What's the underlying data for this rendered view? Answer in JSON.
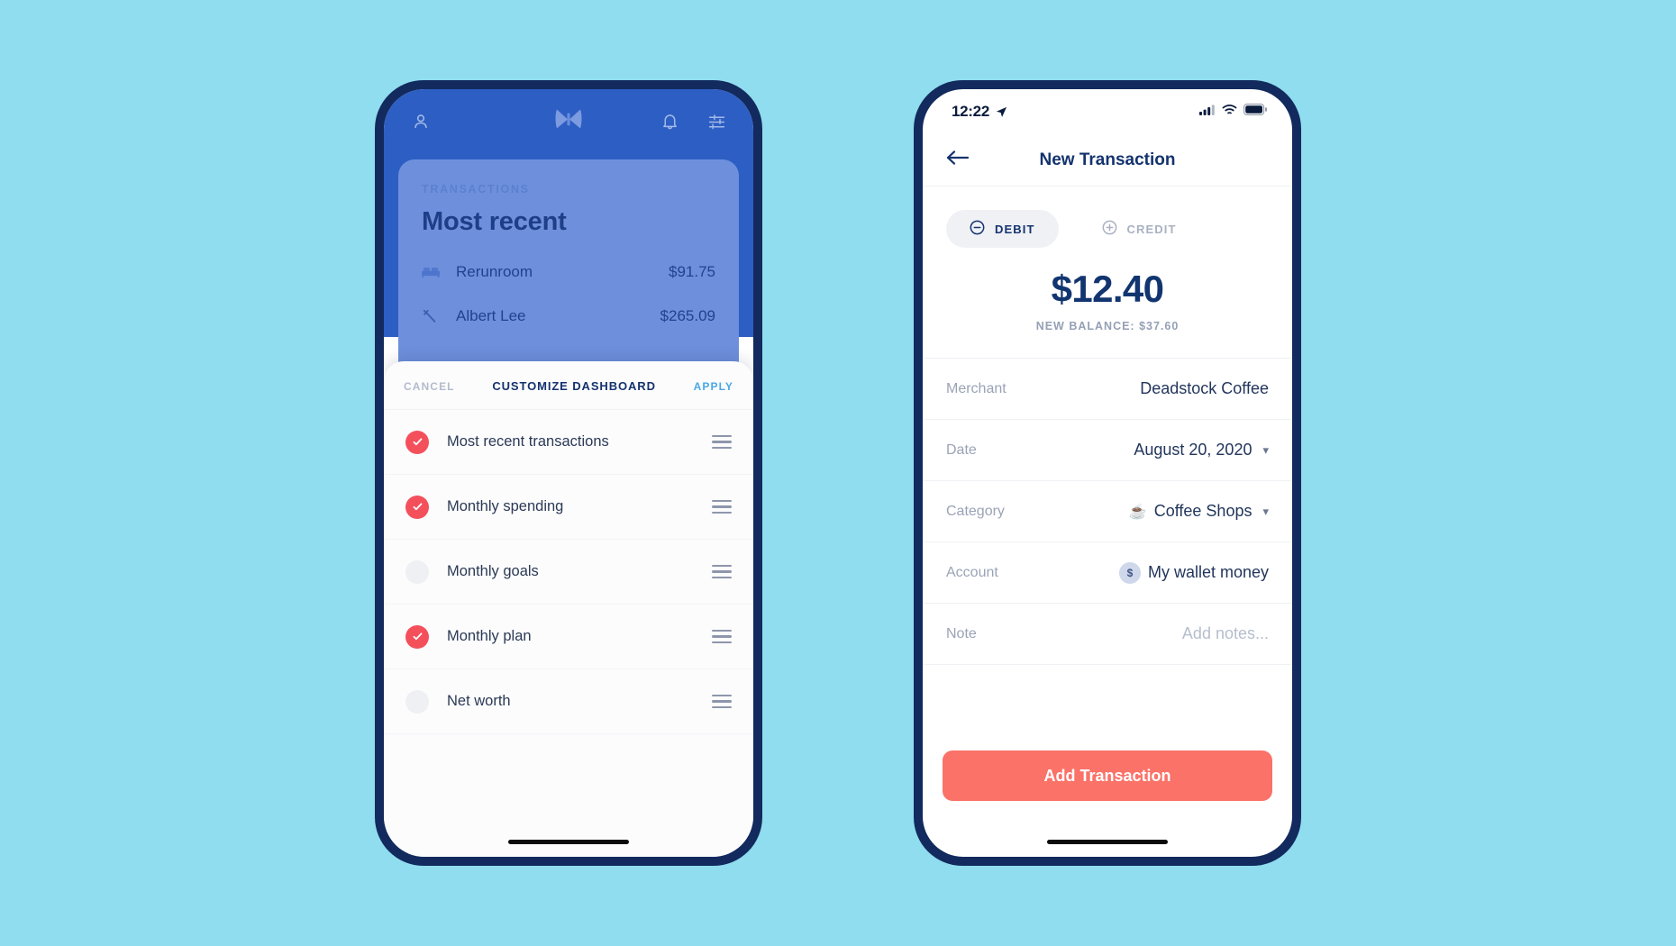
{
  "canvas": {
    "background_color": "#8FDDEE"
  },
  "left_phone": {
    "topbar": {
      "profile_icon": "person-icon",
      "logo_icon": "butterfly-logo-icon",
      "notifications_icon": "bell-icon",
      "settings_icon": "sliders-icon"
    },
    "transactions_card": {
      "kicker": "TRANSACTIONS",
      "title": "Most recent",
      "rows": [
        {
          "icon": "bed-icon",
          "name": "Rerunroom",
          "amount": "$91.75"
        },
        {
          "icon": "hammer-icon",
          "name": "Albert Lee",
          "amount": "$265.09"
        }
      ]
    },
    "sheet": {
      "cancel_label": "CANCEL",
      "title": "CUSTOMIZE DASHBOARD",
      "apply_label": "APPLY",
      "apply_color": "#4AA8E8",
      "checked_color": "#F4505B",
      "unchecked_color": "#EFF0F3",
      "items": [
        {
          "label": "Most recent transactions",
          "checked": true
        },
        {
          "label": "Monthly spending",
          "checked": true
        },
        {
          "label": "Monthly goals",
          "checked": false
        },
        {
          "label": "Monthly plan",
          "checked": true
        },
        {
          "label": "Net worth",
          "checked": false
        }
      ]
    }
  },
  "right_phone": {
    "statusbar": {
      "time": "12:22",
      "location_icon": "location-arrow-icon",
      "signal_icon": "cellular-signal-icon",
      "wifi_icon": "wifi-icon",
      "battery_icon": "battery-icon"
    },
    "nav": {
      "back_icon": "arrow-left-icon",
      "title": "New Transaction"
    },
    "type_toggle": {
      "options": [
        {
          "label": "DEBIT",
          "icon": "minus-circle-icon",
          "selected": true
        },
        {
          "label": "CREDIT",
          "icon": "plus-circle-icon",
          "selected": false
        }
      ]
    },
    "amount_block": {
      "amount": "$12.40",
      "new_balance": "NEW BALANCE: $37.60"
    },
    "form": {
      "rows": [
        {
          "label": "Merchant",
          "value": "Deadstock Coffee",
          "chevron": false,
          "emoji": "",
          "badge": ""
        },
        {
          "label": "Date",
          "value": "August 20, 2020",
          "chevron": true,
          "emoji": "",
          "badge": ""
        },
        {
          "label": "Category",
          "value": "Coffee Shops",
          "chevron": true,
          "emoji": "☕",
          "badge": ""
        },
        {
          "label": "Account",
          "value": "My wallet money",
          "chevron": false,
          "emoji": "",
          "badge": "$"
        },
        {
          "label": "Note",
          "value": "Add notes...",
          "chevron": false,
          "emoji": "",
          "badge": "",
          "placeholder": true
        }
      ]
    },
    "cta": {
      "label": "Add Transaction",
      "color": "#FA7268"
    }
  }
}
